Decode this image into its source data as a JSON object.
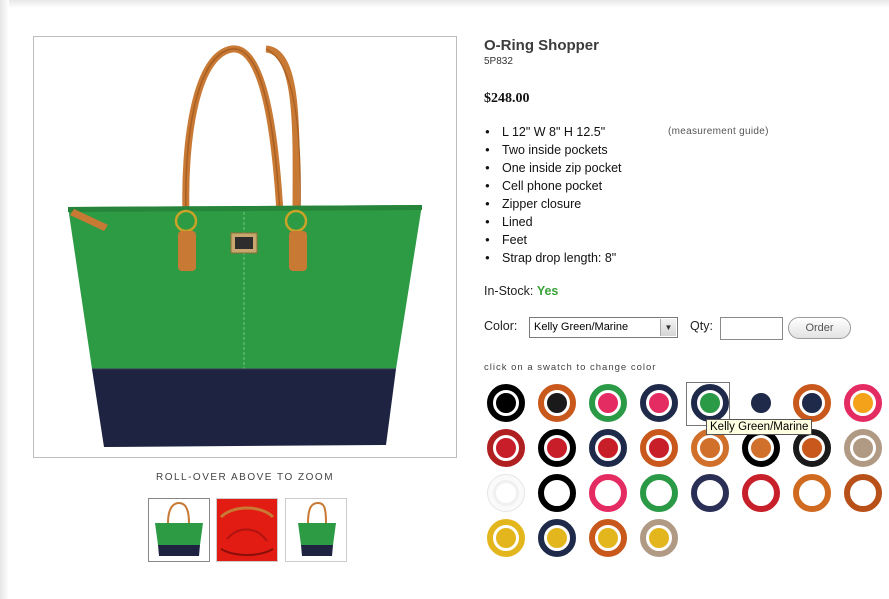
{
  "product": {
    "name": "O-Ring Shopper",
    "sku": "5P832",
    "price": "$248.00",
    "features": [
      "L 12\"  W 8\"  H 12.5\"",
      "Two inside pockets",
      "One inside zip pocket",
      "Cell phone pocket",
      "Zipper closure",
      "Lined",
      "Feet",
      "Strap drop length: 8\""
    ],
    "measurement_link": "(measurement guide)",
    "stock_label": "In-Stock:",
    "stock_value": "Yes"
  },
  "purchase": {
    "color_label": "Color:",
    "color_selected": "Kelly Green/Marine",
    "qty_label": "Qty:",
    "qty_value": "",
    "order_label": "Order"
  },
  "gallery": {
    "zoom_caption": "ROLL-OVER ABOVE TO ZOOM",
    "thumbnails": [
      "front-view",
      "interior-view",
      "side-view"
    ],
    "selected_thumbnail": 0
  },
  "swatches": {
    "hint": "click on a swatch to change color",
    "tooltip": "Kelly Green/Marine",
    "hovered_index": 4,
    "rows": [
      [
        {
          "outer": "#000000",
          "ring": "#ffffff",
          "inner": "#000000"
        },
        {
          "outer": "#c8581c",
          "ring": "#c8581c",
          "inner": "#1a1a1a"
        },
        {
          "outer": "#2a9a46",
          "ring": "#2a9a46",
          "inner": "#e42b62"
        },
        {
          "outer": "#1f2a4a",
          "ring": "#1f2a4a",
          "inner": "#e42b62"
        },
        {
          "outer": "#1f2a4a",
          "ring": "#1f2a4a",
          "inner": "#2a9a46"
        },
        {
          "outer": "#ffffff",
          "ring": "#ffffff",
          "inner": "#1f2a4a"
        },
        {
          "outer": "#c8581c",
          "ring": "#c8581c",
          "inner": "#1f2a4a"
        },
        {
          "outer": "#e42b62",
          "ring": "#e42b62",
          "inner": "#f4a21a"
        }
      ],
      [
        {
          "outer": "#b02020",
          "ring": "#b02020",
          "inner": "#c81e2a"
        },
        {
          "outer": "#000000",
          "ring": "#000000",
          "inner": "#c81e2a"
        },
        {
          "outer": "#1f2a4a",
          "ring": "#1f2a4a",
          "inner": "#c81e2a"
        },
        {
          "outer": "#c8581c",
          "ring": "#c8581c",
          "inner": "#c81e2a"
        },
        {
          "outer": "#d0702a",
          "ring": "#d0702a",
          "inner": "#d0702a"
        },
        {
          "outer": "#000000",
          "ring": "#000000",
          "inner": "#d0702a"
        },
        {
          "outer": "#1a1a1a",
          "ring": "#1a1a1a",
          "inner": "#c8581c"
        },
        {
          "outer": "#b09a84",
          "ring": "#b09a84",
          "inner": "#b09a84"
        }
      ],
      [
        {
          "outer": "#fafafa",
          "ring": "#f0f0f0",
          "inner": "#ffffff"
        },
        {
          "outer": "#000000",
          "ring": "#000000",
          "inner": "#ffffff"
        },
        {
          "outer": "#e42b62",
          "ring": "#e42b62",
          "inner": "#ffffff"
        },
        {
          "outer": "#2a9a46",
          "ring": "#2a9a46",
          "inner": "#ffffff"
        },
        {
          "outer": "#2a2f55",
          "ring": "#2a2f55",
          "inner": "#ffffff"
        },
        {
          "outer": "#c8202a",
          "ring": "#c8202a",
          "inner": "#ffffff"
        },
        {
          "outer": "#d06a20",
          "ring": "#d06a20",
          "inner": "#ffffff"
        },
        {
          "outer": "#b8501a",
          "ring": "#b8501a",
          "inner": "#ffffff"
        }
      ],
      [
        {
          "outer": "#e4b61e",
          "ring": "#e4b61e",
          "inner": "#e4b61e"
        },
        {
          "outer": "#1f2a4a",
          "ring": "#1f2a4a",
          "inner": "#e4b61e"
        },
        {
          "outer": "#c8581c",
          "ring": "#c8581c",
          "inner": "#e4b61e"
        },
        {
          "outer": "#b09a84",
          "ring": "#b09a84",
          "inner": "#e4b61e"
        }
      ]
    ]
  },
  "colors": {
    "bag_green": "#2d9b44",
    "bag_navy": "#1d2340",
    "leather": "#c87934",
    "stock_yes": "#3aa33a"
  }
}
